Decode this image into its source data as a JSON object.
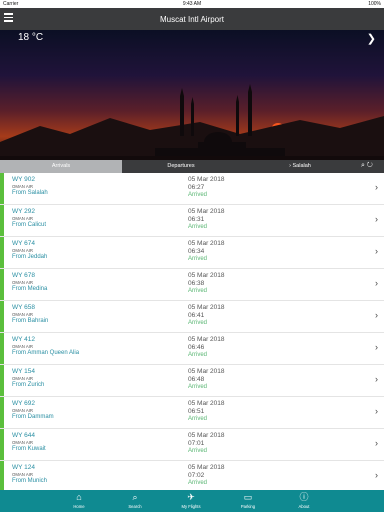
{
  "status_bar": {
    "carrier": "Carrier",
    "time": "9:43 AM",
    "battery": "100%"
  },
  "nav": {
    "title": "Muscat Intl Airport"
  },
  "hero": {
    "temperature": "18 °C"
  },
  "tabs": {
    "arrivals": "Arrivals",
    "departures": "Departures",
    "salalah": "Salalah"
  },
  "flights": [
    {
      "flight": "WY 902",
      "airline": "OMAN AIR",
      "from": "From Salalah",
      "date": "05 Mar 2018",
      "time": "06:27",
      "status": "Arrived"
    },
    {
      "flight": "WY 292",
      "airline": "OMAN AIR",
      "from": "From Calicut",
      "date": "05 Mar 2018",
      "time": "06:31",
      "status": "Arrived"
    },
    {
      "flight": "WY 674",
      "airline": "OMAN AIR",
      "from": "From Jeddah",
      "date": "05 Mar 2018",
      "time": "06:34",
      "status": "Arrived"
    },
    {
      "flight": "WY 678",
      "airline": "OMAN AIR",
      "from": "From Medina",
      "date": "05 Mar 2018",
      "time": "06:38",
      "status": "Arrived"
    },
    {
      "flight": "WY 658",
      "airline": "OMAN AIR",
      "from": "From Bahrain",
      "date": "05 Mar 2018",
      "time": "06:41",
      "status": "Arrived"
    },
    {
      "flight": "WY 412",
      "airline": "OMAN AIR",
      "from": "From Amman Queen Alia",
      "date": "05 Mar 2018",
      "time": "06:46",
      "status": "Arrived"
    },
    {
      "flight": "WY 154",
      "airline": "OMAN AIR",
      "from": "From Zurich",
      "date": "05 Mar 2018",
      "time": "06:48",
      "status": "Arrived"
    },
    {
      "flight": "WY 692",
      "airline": "OMAN AIR",
      "from": "From Dammam",
      "date": "05 Mar 2018",
      "time": "06:51",
      "status": "Arrived"
    },
    {
      "flight": "WY 644",
      "airline": "OMAN AIR",
      "from": "From Kuwait",
      "date": "05 Mar 2018",
      "time": "07:01",
      "status": "Arrived"
    },
    {
      "flight": "WY 124",
      "airline": "OMAN AIR",
      "from": "From Munich",
      "date": "05 Mar 2018",
      "time": "07:02",
      "status": "Arrived"
    }
  ],
  "tabbar": {
    "home": "Home",
    "search": "Search",
    "my_flights": "My Flights",
    "parking": "Parking",
    "about": "About"
  },
  "colors": {
    "accent": "#0f8a91",
    "header": "#3a3b3d",
    "flight_text": "#2a8fa3",
    "arrived": "#59b673",
    "row_bar": "#5bbf3c"
  }
}
